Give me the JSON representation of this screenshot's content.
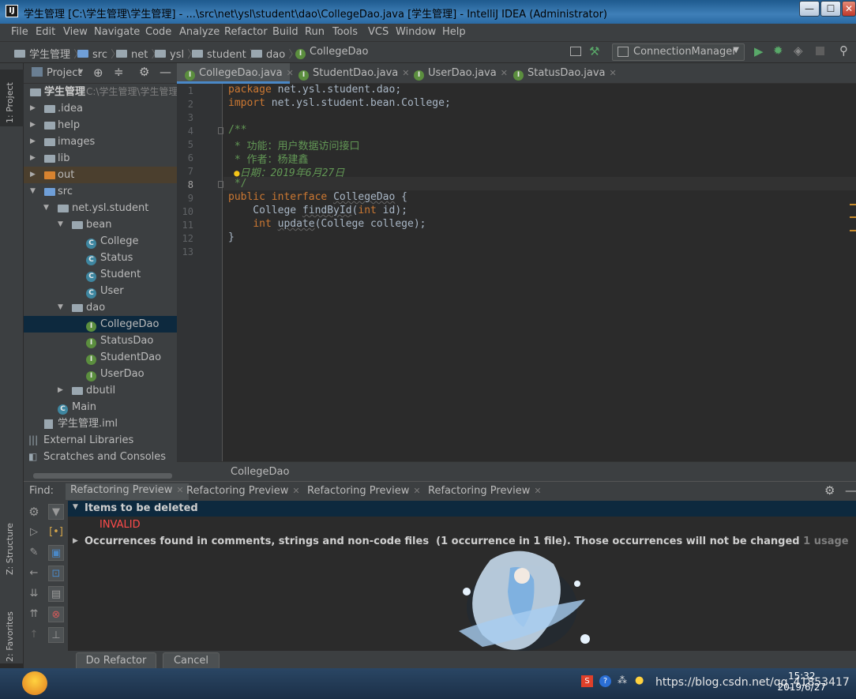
{
  "window": {
    "app_icon": "IJ",
    "title": "学生管理 [C:\\学生管理\\学生管理] - ...\\src\\net\\ysl\\student\\dao\\CollegeDao.java [学生管理] - IntelliJ IDEA (Administrator)",
    "min": "—",
    "max": "☐",
    "close": "✕"
  },
  "menu": [
    "File",
    "Edit",
    "View",
    "Navigate",
    "Code",
    "Analyze",
    "Refactor",
    "Build",
    "Run",
    "Tools",
    "VCS",
    "Window",
    "Help"
  ],
  "breadcrumb": [
    "学生管理",
    "src",
    "net",
    "ysl",
    "student",
    "dao",
    "CollegeDao"
  ],
  "run_config": "ConnectionManager",
  "left_strip": {
    "project": "1: Project",
    "structure": "Z: Structure",
    "favorites": "2: Favorites"
  },
  "project_panel": {
    "header": "Project",
    "tree": [
      {
        "label": "学生管理",
        "hint": "C:\\学生管理\\学生管理",
        "kind": "root"
      },
      {
        "label": ".idea",
        "kind": "folder"
      },
      {
        "label": "help",
        "kind": "folder"
      },
      {
        "label": "images",
        "kind": "folder"
      },
      {
        "label": "lib",
        "kind": "folder"
      },
      {
        "label": "out",
        "kind": "folder-orange"
      },
      {
        "label": "src",
        "kind": "folder-blue"
      },
      {
        "label": "net.ysl.student",
        "kind": "package"
      },
      {
        "label": "bean",
        "kind": "package"
      },
      {
        "label": "College",
        "kind": "class"
      },
      {
        "label": "Status",
        "kind": "class"
      },
      {
        "label": "Student",
        "kind": "class"
      },
      {
        "label": "User",
        "kind": "class"
      },
      {
        "label": "dao",
        "kind": "package"
      },
      {
        "label": "CollegeDao",
        "kind": "interface"
      },
      {
        "label": "StatusDao",
        "kind": "interface"
      },
      {
        "label": "StudentDao",
        "kind": "interface"
      },
      {
        "label": "UserDao",
        "kind": "interface"
      },
      {
        "label": "dbutil",
        "kind": "package"
      },
      {
        "label": "Main",
        "kind": "class"
      },
      {
        "label": "学生管理.iml",
        "kind": "file"
      },
      {
        "label": "External Libraries",
        "kind": "libs"
      },
      {
        "label": "Scratches and Consoles",
        "kind": "scratch"
      }
    ]
  },
  "editor": {
    "tabs": [
      "CollegeDao.java",
      "StudentDao.java",
      "UserDao.java",
      "StatusDao.java"
    ],
    "line_numbers": [
      "1",
      "2",
      "3",
      "4",
      "5",
      "6",
      "7",
      "8",
      "9",
      "10",
      "11",
      "12",
      "13"
    ],
    "code": {
      "l1_kw": "package",
      "l1_rest": " net.ysl.student.dao;",
      "l2_kw": "import",
      "l2_rest": " net.ysl.student.bean.College;",
      "l4": "/**",
      "l5": " * 功能：用户数据访问接口",
      "l6": " * 作者：杨建鑫",
      "l7": "日期：2019年6月27日",
      "l8": " */",
      "l9_kw": "public interface ",
      "l9_name": "CollegeDao",
      "l9_rest": " {",
      "l10_a": "    College ",
      "l10_m": "findById",
      "l10_b": "(",
      "l10_kw": "int",
      "l10_c": " id);",
      "l11_a": "    ",
      "l11_kw": "int",
      "l11_sp": " ",
      "l11_m": "update",
      "l11_c": "(College college);",
      "l12": "}"
    },
    "footer_crumb": "CollegeDao"
  },
  "find": {
    "label": "Find:",
    "tabs": [
      "Refactoring Preview",
      "Refactoring Preview",
      "Refactoring Preview",
      "Refactoring Preview"
    ],
    "items_header": "Items to be deleted",
    "invalid": "INVALID",
    "occurrences": "Occurrences found in comments, strings and non-code files",
    "occ_detail": "(1 occurrence in 1 file). Those occurrences will not be changed",
    "usage": "1 usage",
    "do_refactor": "Do Refactor",
    "cancel": "Cancel"
  },
  "taskbar": {
    "url": "https://blog.csdn.net/qq_41853417",
    "time": "15:32",
    "date": "2019/6/27"
  },
  "colors": {
    "keyword": "#cc7832",
    "comment": "#629755",
    "selection": "#0d293e",
    "invalid": "#ff4b4b"
  }
}
